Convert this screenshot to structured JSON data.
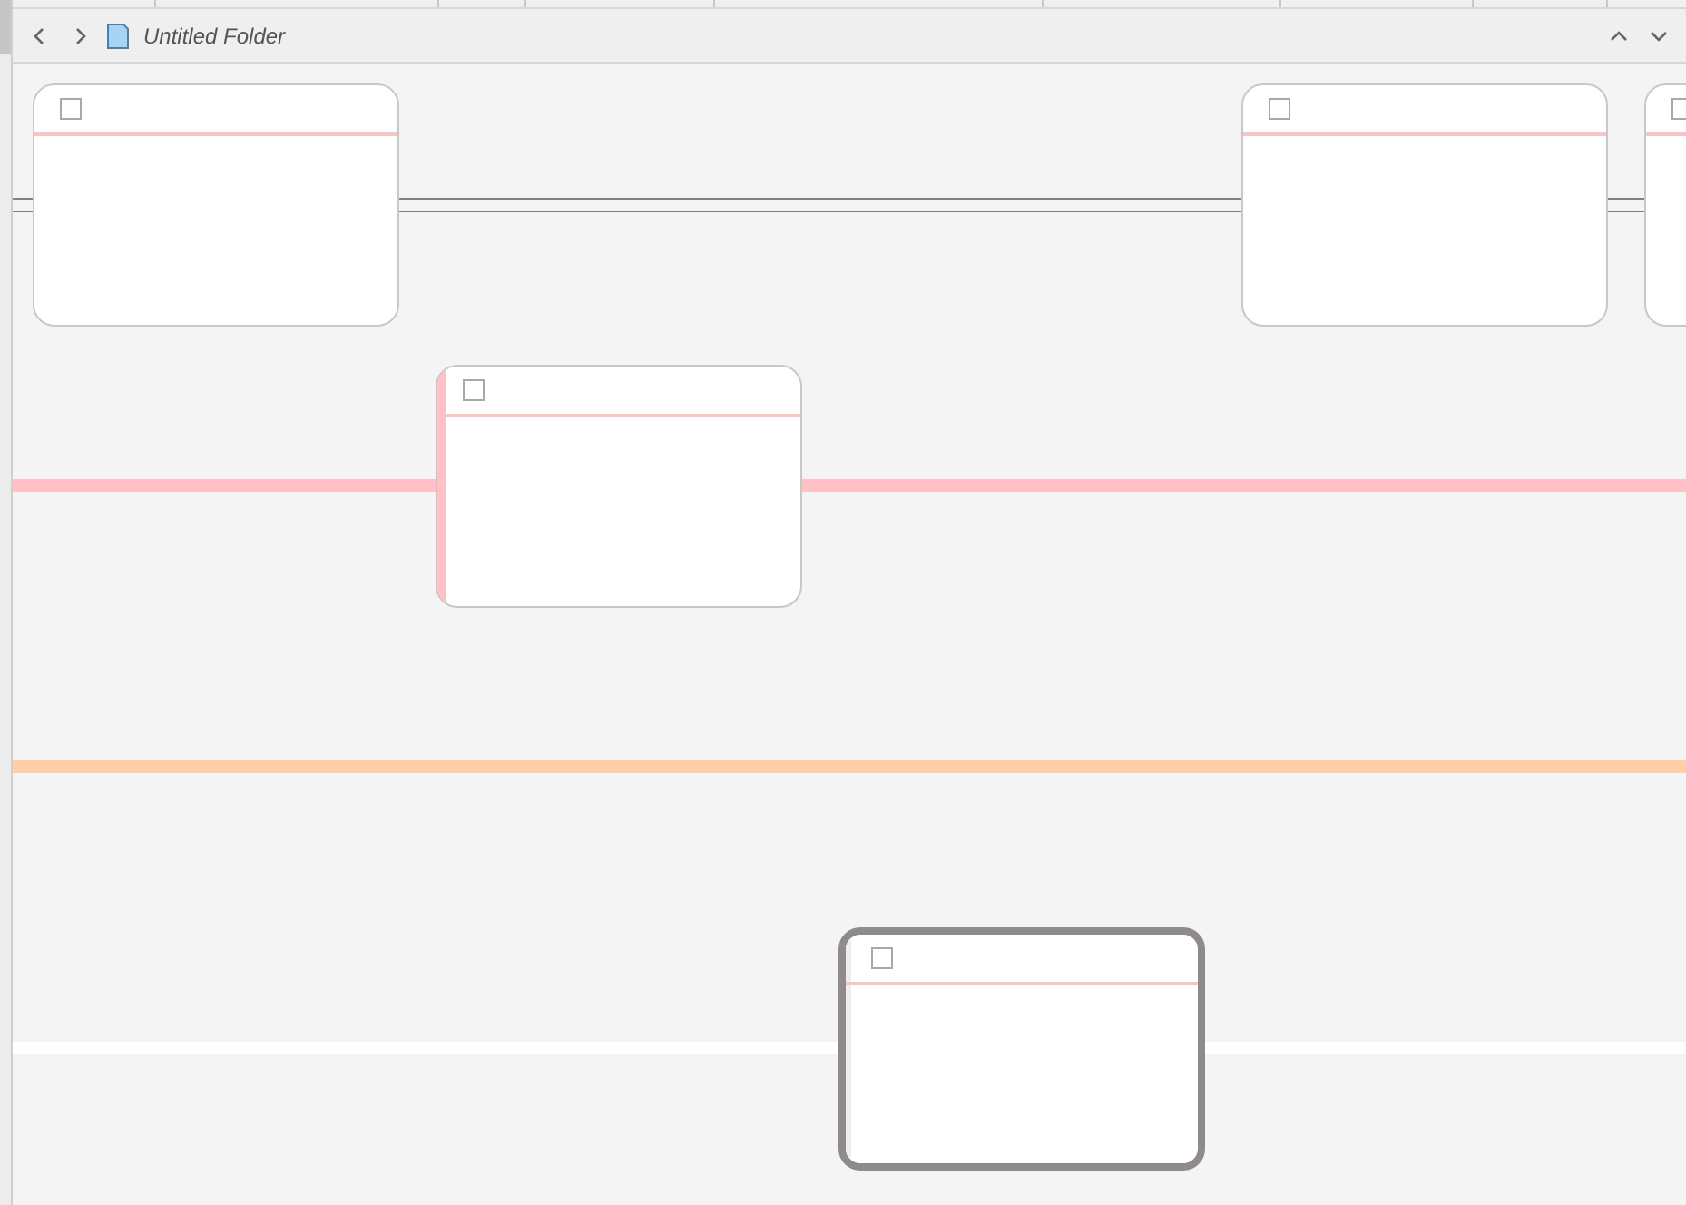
{
  "toolbar": {
    "title": "Untitled Folder"
  },
  "lanes": [
    {
      "kind": "double",
      "color": "#808080",
      "cards": [
        {
          "kind": "plain",
          "checked": false,
          "selected": false
        },
        {
          "kind": "plain",
          "checked": false,
          "selected": false
        },
        {
          "kind": "plain",
          "checked": false,
          "selected": false
        }
      ]
    },
    {
      "kind": "thick",
      "color": "#ffc0c6",
      "cards": [
        {
          "kind": "marked",
          "checked": false,
          "selected": false
        }
      ]
    },
    {
      "kind": "thick",
      "color": "#ffd0a8"
    },
    {
      "kind": "thick",
      "color": "#ffffff",
      "cards": [
        {
          "kind": "marked",
          "checked": false,
          "selected": true
        }
      ]
    }
  ]
}
